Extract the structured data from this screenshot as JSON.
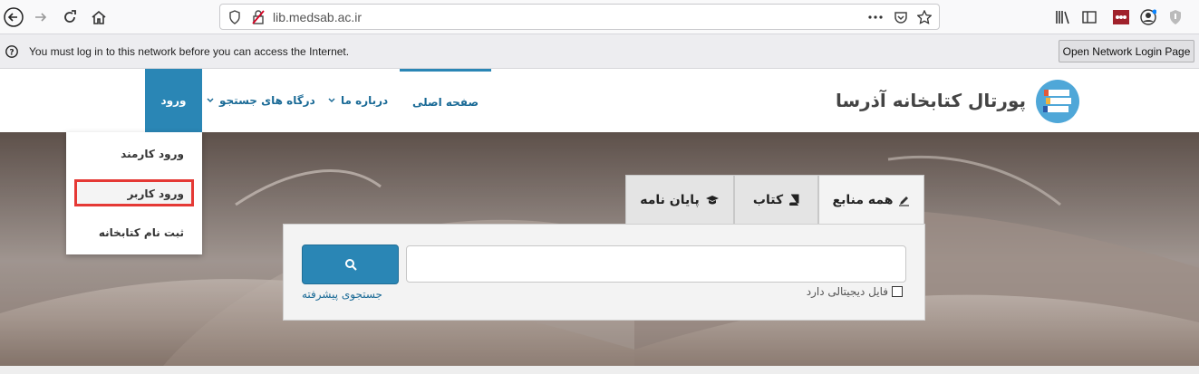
{
  "browser": {
    "url": "lib.medsab.ac.ir"
  },
  "notification": {
    "message": "You must log in to this network before you can access the Internet.",
    "button_label": "Open Network Login Page"
  },
  "site": {
    "logo_text": "پورتال کتابخانه آذرسا",
    "nav": {
      "login": "ورود",
      "search_gateways": "درگاه های جستجو",
      "about": "درباره ما",
      "home": "صفحه اصلی"
    },
    "dropdown": {
      "staff_login": "ورود کارمند",
      "user_login": "ورود کاربر",
      "register": "ثبت نام کتابخانه"
    }
  },
  "search": {
    "tabs": {
      "all": "همه منابع",
      "book": "کتاب",
      "thesis": "پایان نامه"
    },
    "advanced_link": "جستجوی پیشرفته",
    "digital_file_label": "فایل دیجیتالی دارد",
    "input_value": ""
  },
  "colors": {
    "accent": "#2a86b5",
    "highlight": "#e53935"
  }
}
